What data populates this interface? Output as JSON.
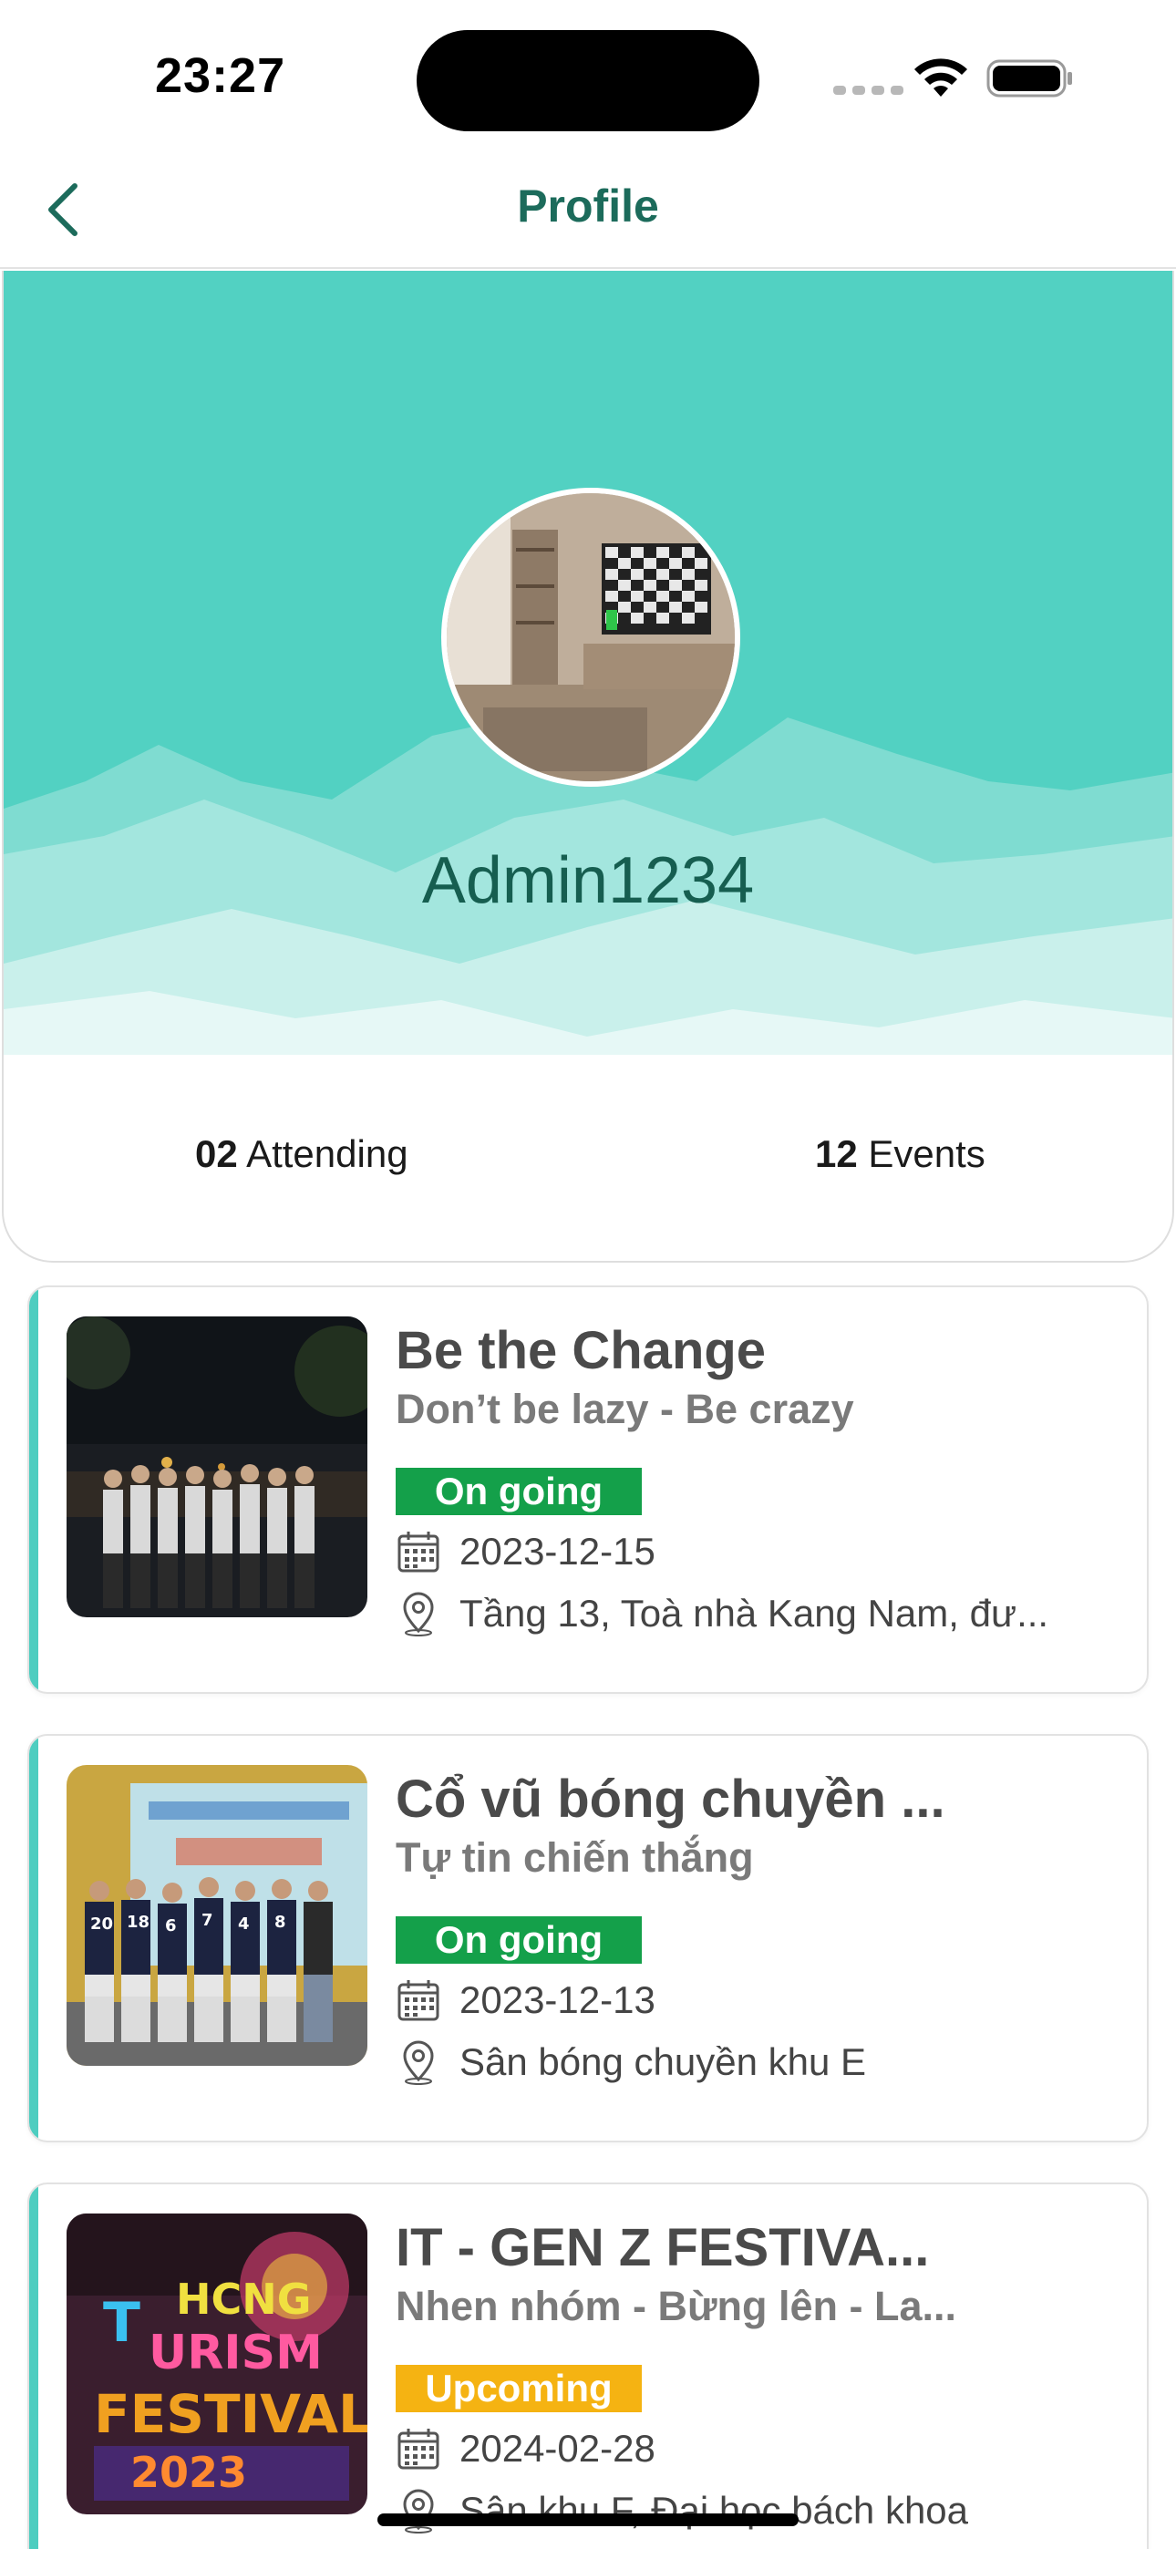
{
  "status_bar": {
    "time": "23:27",
    "icons": [
      "signal-icon",
      "wifi-icon",
      "battery-icon"
    ]
  },
  "nav": {
    "title": "Profile",
    "back_icon": "chevron-left-icon"
  },
  "profile": {
    "username": "Admin1234",
    "stats": {
      "attending_count": "02",
      "attending_label": "Attending",
      "events_count": "12",
      "events_label": "Events"
    }
  },
  "events": [
    {
      "title": "Be the Change",
      "subtitle": "Don’t be lazy - Be crazy",
      "status": "On going",
      "date": "2023-12-15",
      "location": "Tầng 13, Toà nhà Kang Nam, đư..."
    },
    {
      "title": "Cổ vũ bóng chuyền ...",
      "subtitle": "Tự tin chiến thắng",
      "status": "On going",
      "date": "2023-12-13",
      "location": "Sân bóng chuyền khu E"
    },
    {
      "title": "IT - GEN Z FESTIVA...",
      "subtitle": "Nhen nhóm - Bừng lên - La...",
      "status": "Upcoming",
      "date": "2024-02-28",
      "location": "Sân khu F, Đại học bách khoa"
    }
  ],
  "colors": {
    "accent": "#4ecdc0",
    "title_green": "#1c6b5b",
    "ongoing": "#14a04a",
    "upcoming": "#f5b312"
  }
}
